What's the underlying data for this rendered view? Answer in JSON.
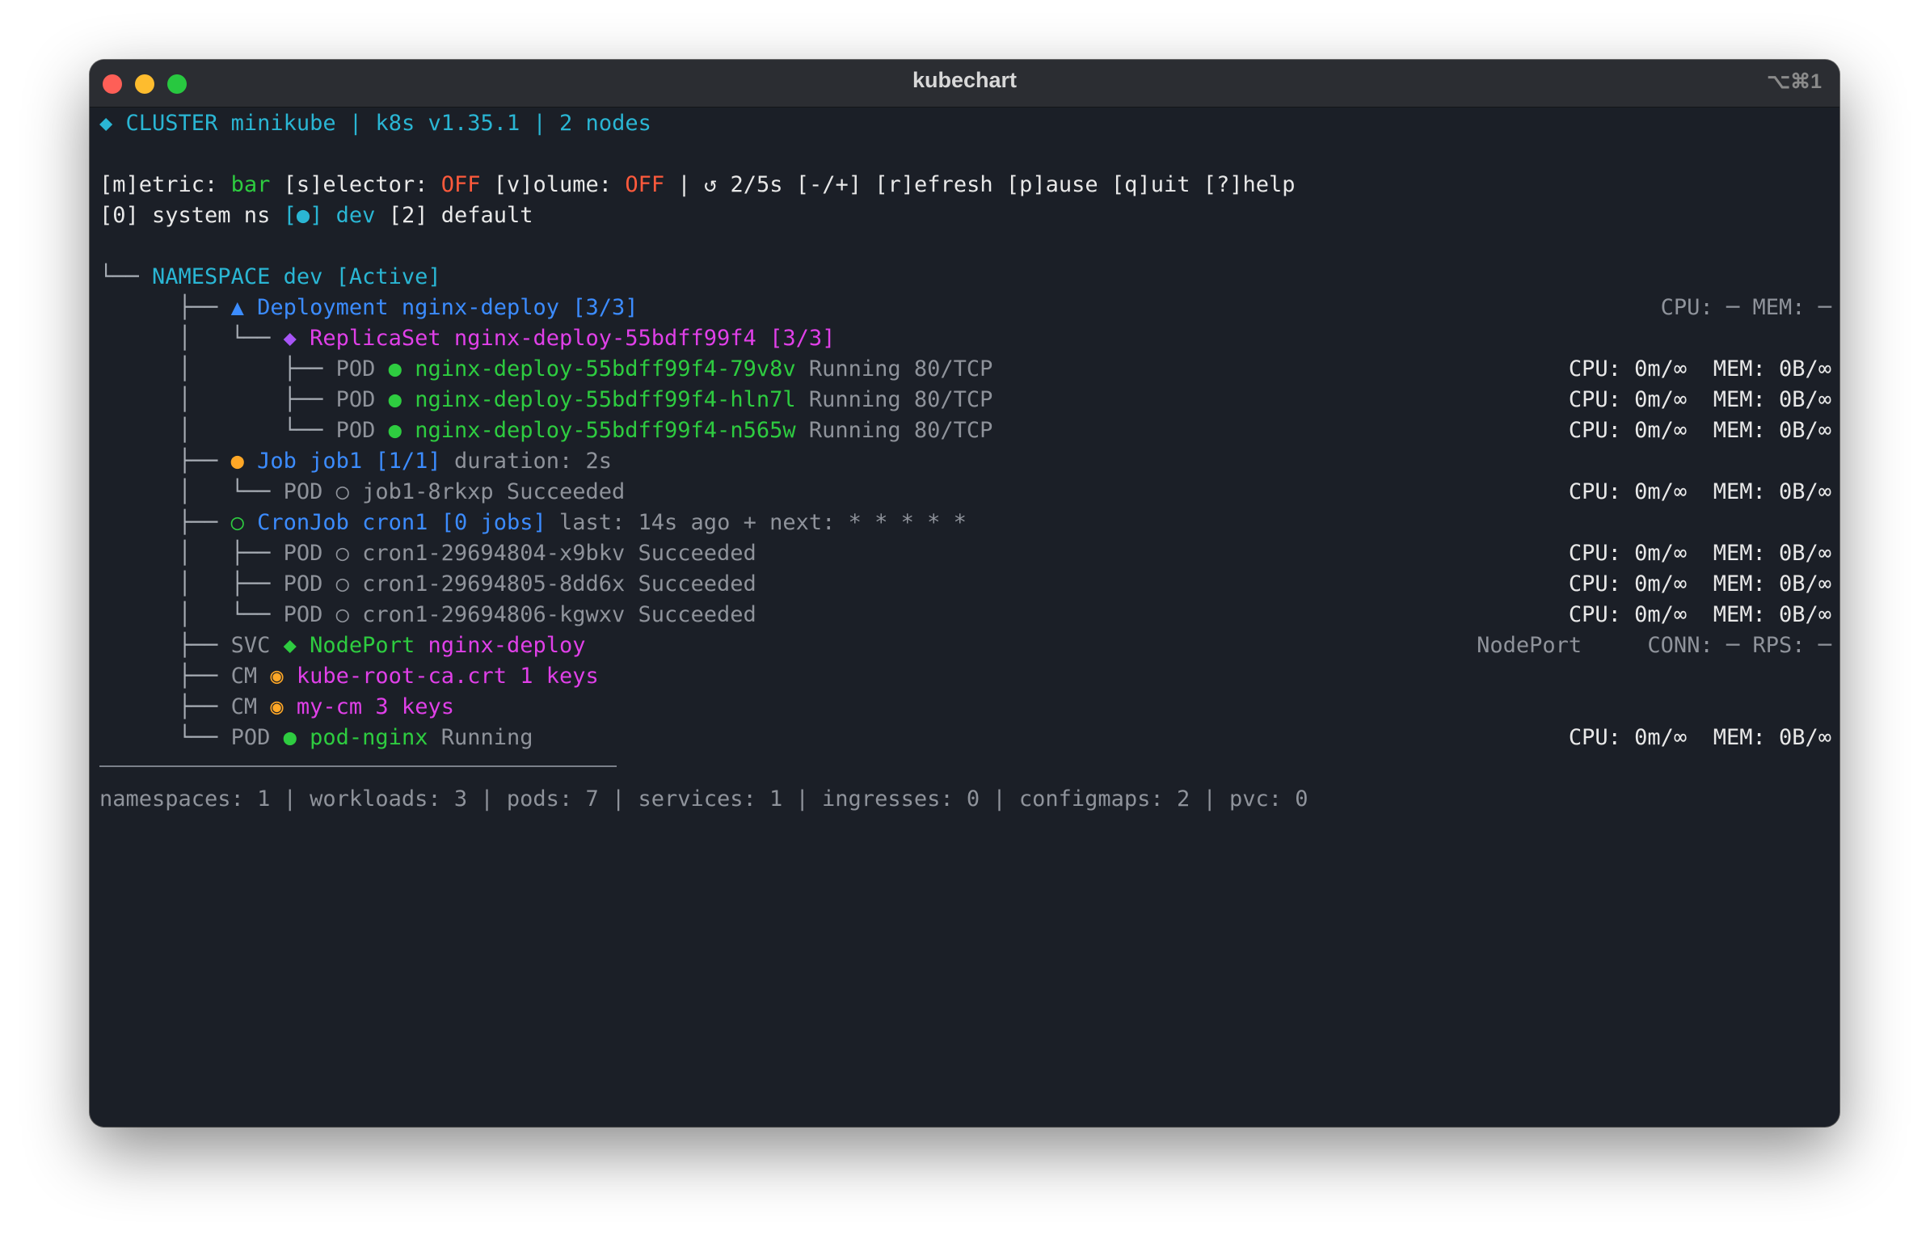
{
  "window": {
    "title": "kubechart",
    "shortcut": "⌥⌘1"
  },
  "header": {
    "icon": "◆",
    "label": "CLUSTER",
    "name": "minikube",
    "sep1": "|",
    "version": "k8s v1.35.1",
    "sep2": "|",
    "nodes": "2 nodes"
  },
  "controls": {
    "metric_key": "[m]etric:",
    "metric_val": "bar",
    "selector_key": "[s]elector:",
    "selector_val": "OFF",
    "volume_key": "[v]olume:",
    "volume_val": "OFF",
    "sep": "|",
    "refresh_icon": "↺",
    "interval": "2/5s",
    "adjust": "[-/+]",
    "refresh": "[r]efresh",
    "pause": "[p]ause",
    "quit": "[q]uit",
    "help": "[?]help"
  },
  "ns_tabs": {
    "tab0": "[0] system ns",
    "tab1_bracket": "[●]",
    "tab1_name": "dev",
    "tab2": "[2] default"
  },
  "tree": {
    "namespace": {
      "branch": "└── ",
      "label": "NAMESPACE dev [Active]"
    },
    "deployment": {
      "branch": "├── ",
      "icon": "▲",
      "label": "Deployment nginx-deploy [3/3]",
      "metrics": "CPU: ─ MEM: ─"
    },
    "replicaset": {
      "branch": "└── ",
      "icon": "◆",
      "label": "ReplicaSet nginx-deploy-55bdff99f4 [3/3]"
    },
    "pods_rs": [
      {
        "branch": "├── ",
        "kind": "POD",
        "dot": "●",
        "name": "nginx-deploy-55bdff99f4-79v8v",
        "status": "Running 80/TCP",
        "cpu": "CPU: 0m/∞",
        "mem": "MEM: 0B/∞"
      },
      {
        "branch": "├── ",
        "kind": "POD",
        "dot": "●",
        "name": "nginx-deploy-55bdff99f4-hln7l",
        "status": "Running 80/TCP",
        "cpu": "CPU: 0m/∞",
        "mem": "MEM: 0B/∞"
      },
      {
        "branch": "└── ",
        "kind": "POD",
        "dot": "●",
        "name": "nginx-deploy-55bdff99f4-n565w",
        "status": "Running 80/TCP",
        "cpu": "CPU: 0m/∞",
        "mem": "MEM: 0B/∞"
      }
    ],
    "job": {
      "branch": "├── ",
      "dot": "●",
      "label": "Job job1 [1/1]",
      "info": "duration: 2s"
    },
    "job_pod": {
      "branch": "└── ",
      "text": "POD ○ job1-8rkxp Succeeded",
      "cpu": "CPU: 0m/∞",
      "mem": "MEM: 0B/∞"
    },
    "cronjob": {
      "branch": "├── ",
      "dot": "○",
      "label": "CronJob cron1 [0 jobs]",
      "info": "last: 14s ago + next: * * * * *"
    },
    "cron_pods": [
      {
        "branch": "├── ",
        "text": "POD ○ cron1-29694804-x9bkv Succeeded",
        "cpu": "CPU: 0m/∞",
        "mem": "MEM: 0B/∞"
      },
      {
        "branch": "├── ",
        "text": "POD ○ cron1-29694805-8dd6x Succeeded",
        "cpu": "CPU: 0m/∞",
        "mem": "MEM: 0B/∞"
      },
      {
        "branch": "└── ",
        "text": "POD ○ cron1-29694806-kgwxv Succeeded",
        "cpu": "CPU: 0m/∞",
        "mem": "MEM: 0B/∞"
      }
    ],
    "svc": {
      "branch": "├── ",
      "kind": "SVC",
      "icon": "◆",
      "type": "NodePort",
      "name": "nginx-deploy",
      "right_type": "NodePort",
      "metrics": "CONN: ─ RPS: ─"
    },
    "cm1": {
      "branch": "├── ",
      "kind": "CM",
      "icon": "◉",
      "name": "kube-root-ca.crt 1 keys"
    },
    "cm2": {
      "branch": "├── ",
      "kind": "CM",
      "icon": "◉",
      "name": "my-cm 3 keys"
    },
    "pod_nginx": {
      "branch": "└── ",
      "kind": "POD",
      "dot": "●",
      "name": "pod-nginx",
      "status": "Running",
      "cpu": "CPU: 0m/∞",
      "mem": "MEM: 0B/∞"
    }
  },
  "summary": "namespaces: 1 | workloads: 3 | pods: 7 | services: 1 | ingresses: 0 | configmaps: 2 | pvc: 0"
}
